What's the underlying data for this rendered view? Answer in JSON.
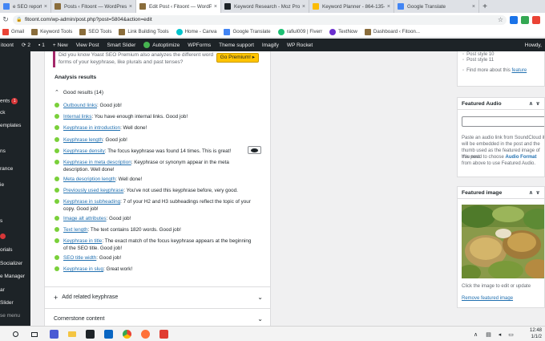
{
  "browser": {
    "tabs": [
      {
        "label": "e SEO report - Google",
        "color": "#4285f4",
        "active": false
      },
      {
        "label": "Posts ‹ Fitoont — WordPress",
        "color": "#8a6d3b",
        "active": false
      },
      {
        "label": "Edit Post ‹ Fitoont — WordPress",
        "color": "#8a6d3b",
        "active": true
      },
      {
        "label": "Keyword Research - Moz Pro",
        "color": "#1d2327",
        "active": false
      },
      {
        "label": "Keyword Planner - 864-135-3",
        "color": "#fbbc04",
        "active": false
      },
      {
        "label": "Google Translate",
        "color": "#4285f4",
        "active": false
      }
    ],
    "tab_close": "×",
    "new_tab": "+",
    "url": "fitoont.com/wp-admin/post.php?post=5804&action=edit",
    "bookmarks": [
      {
        "label": "Gmail",
        "color": "#ea4335"
      },
      {
        "label": "Keyword Tools",
        "color": "#8a6d3b"
      },
      {
        "label": "SEO Tools",
        "color": "#8a6d3b"
      },
      {
        "label": "Link Building Tools",
        "color": "#8a6d3b"
      },
      {
        "label": "Home - Canva",
        "color": "#00c4cc"
      },
      {
        "label": "Google Translate",
        "color": "#4285f4"
      },
      {
        "label": "rafiul009 | Fiverr",
        "color": "#1dbf73"
      },
      {
        "label": "TextNow",
        "color": "#6b2fcf"
      },
      {
        "label": "Dashboard ‹ Fitoon...",
        "color": "#8a6d3b"
      }
    ]
  },
  "adminbar": {
    "site": "itoont",
    "updates": "2",
    "comments": "1",
    "new_label": "New",
    "view_post": "View Post",
    "smart_slider": "Smart Slider",
    "autoptimize": "Autoptimize",
    "wpforms": "WPForms",
    "theme_support": "Theme support",
    "imagify": "Imagify",
    "wp_rocket": "WP Rocket",
    "howdy": "Howdy,"
  },
  "sidemenu": {
    "items": [
      {
        "label": "ents",
        "badge": "1"
      },
      {
        "label": "ck"
      },
      {
        "label": "emplates"
      },
      {
        "label": "ns"
      },
      {
        "label": "rance"
      },
      {
        "label": "ie"
      },
      {
        "label": "s"
      },
      {
        "label": "orials"
      },
      {
        "label": "Socializer"
      },
      {
        "label": "e Manager"
      },
      {
        "label": "ar"
      },
      {
        "label": "Slider"
      },
      {
        "label": "se menu"
      }
    ]
  },
  "yoast": {
    "premium_text": "Did you know Yoast SEO Premium also analyzes the different word forms of your keyphrase, like plurals and past tenses?",
    "premium_button": "Go Premium! ▸",
    "analysis_title": "Analysis results",
    "good_results_label": "Good results (14)",
    "results": [
      {
        "link": "Outbound links",
        "text": ": Good job!"
      },
      {
        "link": "Internal links",
        "text": ": You have enough internal links. Good job!"
      },
      {
        "link": "Keyphrase in introduction",
        "text": ": Well done!"
      },
      {
        "link": "Keyphrase length",
        "text": ": Good job!"
      },
      {
        "link": "Keyphrase density",
        "text": ": The focus keyphrase was found 14 times. This is great!"
      },
      {
        "link": "Keyphrase in meta description",
        "text": ": Keyphrase or synonym appear in the meta description. Well done!"
      },
      {
        "link": "Meta description length",
        "text": ": Well done!"
      },
      {
        "link": "Previously used keyphrase",
        "text": ": You've not used this keyphrase before, very good."
      },
      {
        "link": "Keyphrase in subheading",
        "text": ": 7 of your H2 and H3 subheadings reflect the topic of your copy. Good job!"
      },
      {
        "link": "Image alt attributes",
        "text": ": Good job!"
      },
      {
        "link": "Text length",
        "text": ": The text contains 1820 words. Good job!"
      },
      {
        "link": "Keyphrase in title",
        "text": ": The exact match of the focus keyphrase appears at the beginning of the SEO title. Good job!"
      },
      {
        "link": "SEO title width",
        "text": ": Good job!"
      },
      {
        "link": "Keyphrase in slug",
        "text": ": Great work!"
      }
    ],
    "add_related": "Add related keyphrase",
    "cornerstone": "Cornerstone content"
  },
  "right_sidebar": {
    "post_style_10": "Post style 10",
    "post_style_11": "Post style 11",
    "find_more_prefix": "Find more about this ",
    "find_more_link": "feature",
    "featured_audio_title": "Featured Audio",
    "audio_help": "Paste an audio link from SoundCloud it will be embedded in the post and the thumb used as the featured image of this post.",
    "audio_help2_prefix": "You need to choose ",
    "audio_help2_bold": "Audio Format",
    "audio_help2_suffix": " from above to use Featured Audio.",
    "featured_image_title": "Featured image",
    "click_to_edit": "Click the image to edit or update",
    "remove_featured": "Remove featured image"
  },
  "taskbar": {
    "time": "12:48",
    "date": "1/1/2"
  }
}
